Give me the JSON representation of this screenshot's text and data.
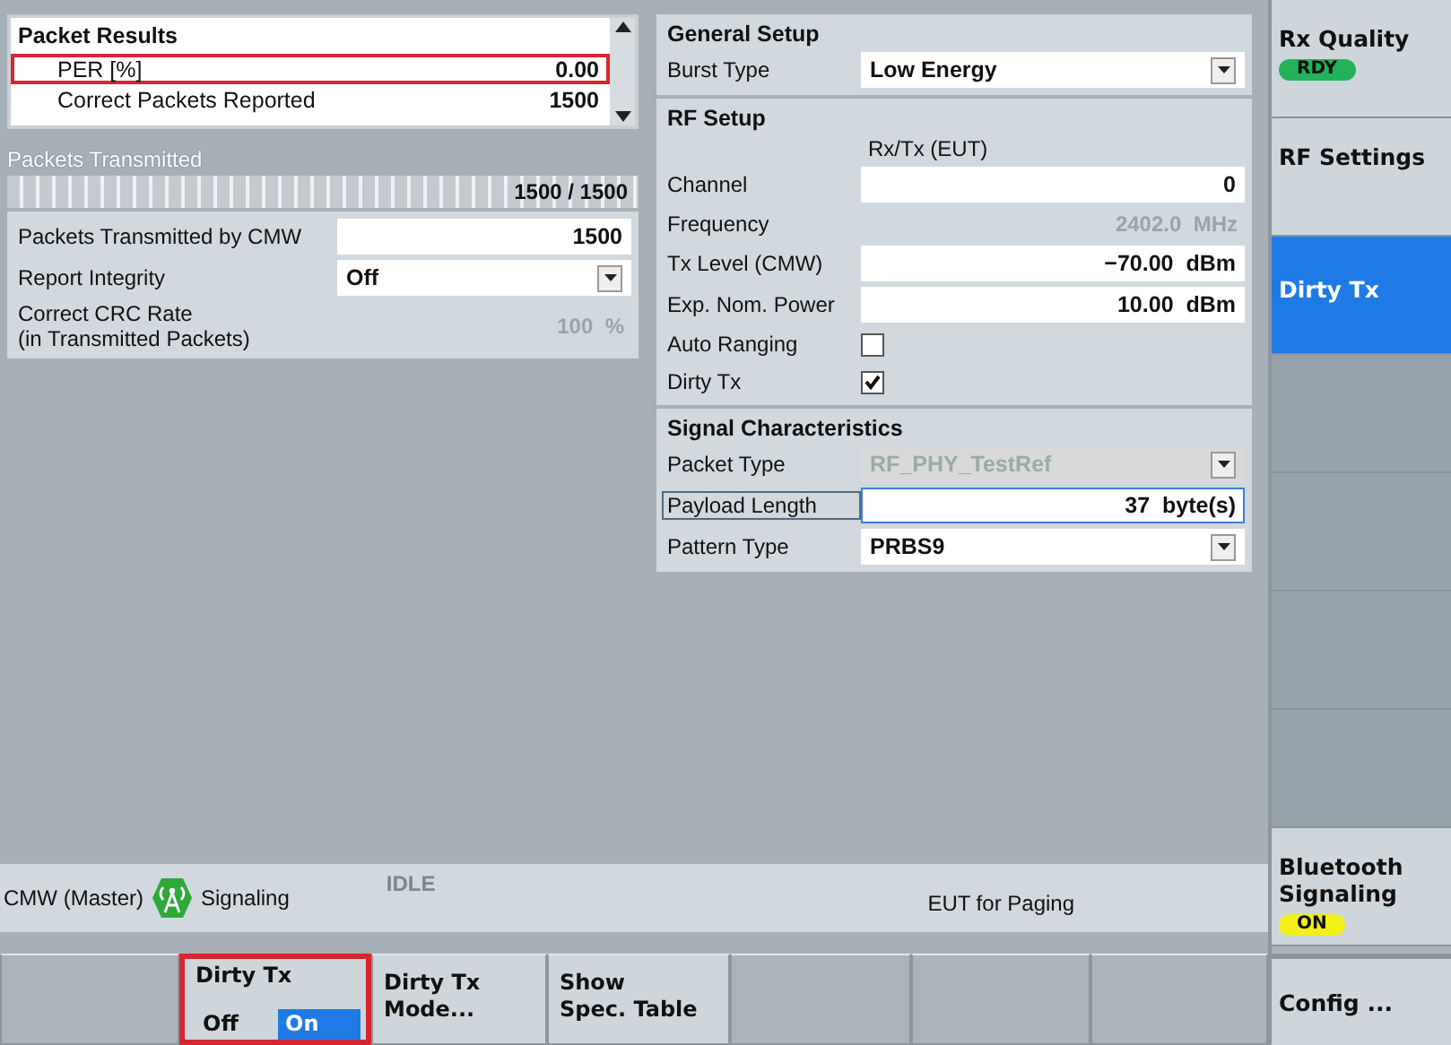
{
  "packet_results": {
    "title": "Packet Results",
    "rows": [
      {
        "label": "PER [%]",
        "value": "0.00",
        "highlighted": true
      },
      {
        "label": "Correct Packets Reported",
        "value": "1500",
        "highlighted": false
      }
    ]
  },
  "packets_transmitted": {
    "label": "Packets Transmitted",
    "level": 1,
    "reading": "1500 / 1500"
  },
  "rx_settings": [
    {
      "kind": "field",
      "label": "Packets Transmitted by CMW",
      "value": "1500"
    },
    {
      "kind": "dropdown",
      "label": "Report Integrity",
      "value": "Off"
    },
    {
      "kind": "readout",
      "label": "Correct CRC Rate\n(in Transmitted Packets)",
      "value": "100",
      "unit": "%"
    }
  ],
  "general_setup": {
    "title": "General Setup",
    "rows": [
      {
        "kind": "dropdown",
        "label": "Burst Type",
        "value": "Low Energy",
        "disabled": false
      }
    ]
  },
  "rf_setup": {
    "title": "RF Setup",
    "column_header": "Rx/Tx (EUT)",
    "rows": [
      {
        "kind": "field",
        "label": "Channel",
        "value": "0",
        "unit": ""
      },
      {
        "kind": "readout",
        "label": "Frequency",
        "value": "2402.0",
        "unit": "MHz"
      },
      {
        "kind": "field",
        "label": "Tx Level (CMW)",
        "value": "−70.00",
        "unit": "dBm"
      },
      {
        "kind": "field",
        "label": "Exp. Nom. Power",
        "value": "10.00",
        "unit": "dBm"
      },
      {
        "kind": "checkbox",
        "label": "Auto Ranging",
        "checked": false
      },
      {
        "kind": "checkbox",
        "label": "Dirty Tx",
        "checked": true
      }
    ]
  },
  "signal_characteristics": {
    "title": "Signal Characteristics",
    "rows": [
      {
        "kind": "dropdown",
        "label": "Packet Type",
        "value": "RF_PHY_TestRef",
        "disabled": true
      },
      {
        "kind": "field",
        "label": "Payload Length",
        "value": "37",
        "unit": "byte(s)",
        "focused": true
      },
      {
        "kind": "dropdown",
        "label": "Pattern Type",
        "value": "PRBS9",
        "disabled": false
      }
    ]
  },
  "status_bar": {
    "instrument": "CMW (Master)",
    "mode": "Signaling",
    "state": "IDLE",
    "message": "EUT for Paging"
  },
  "bottom_softkeys": [
    {
      "kind": "empty"
    },
    {
      "kind": "toggle",
      "label": "Dirty Tx",
      "highlighted": true,
      "options": [
        {
          "label": "Off",
          "selected": false
        },
        {
          "label": "On",
          "selected": true
        }
      ]
    },
    {
      "kind": "button",
      "lines": [
        "Dirty Tx",
        "Mode..."
      ]
    },
    {
      "kind": "button",
      "lines": [
        "Show",
        "Spec. Table"
      ]
    },
    {
      "kind": "empty"
    },
    {
      "kind": "empty"
    },
    {
      "kind": "empty"
    }
  ],
  "side_softkeys": [
    {
      "kind": "button",
      "label": "Rx Quality",
      "selected": false,
      "badge": {
        "text": "RDY",
        "color": "#22b35a"
      }
    },
    {
      "kind": "button",
      "label": "RF Settings",
      "selected": false
    },
    {
      "kind": "button",
      "label": "Dirty Tx",
      "selected": true
    },
    {
      "kind": "empty"
    },
    {
      "kind": "empty"
    },
    {
      "kind": "empty"
    },
    {
      "kind": "empty"
    },
    {
      "kind": "button",
      "label": "Bluetooth Signaling",
      "selected": false,
      "badge": {
        "text": "ON",
        "color": "#f4f01a"
      }
    }
  ],
  "config_softkey": {
    "label": "Config ..."
  }
}
